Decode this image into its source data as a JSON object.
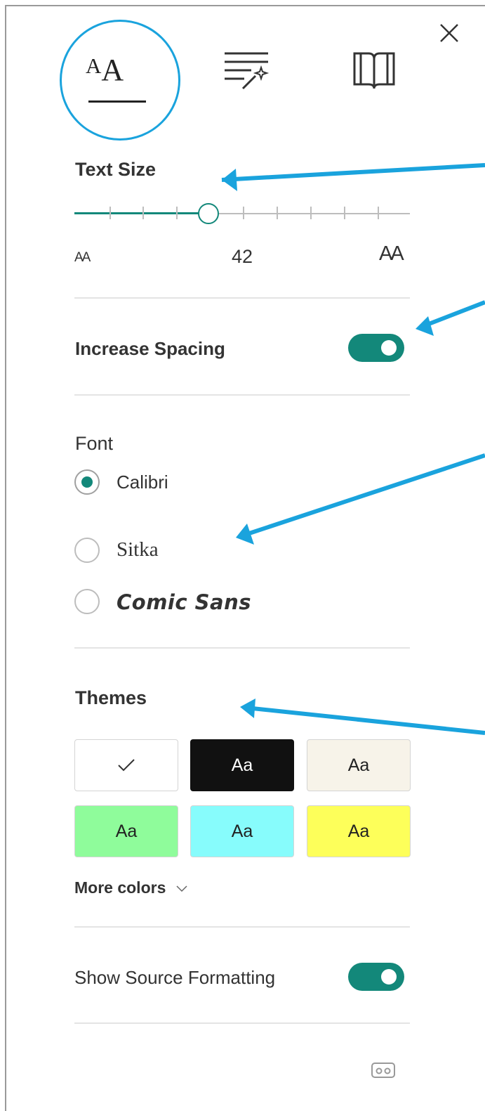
{
  "text_size": {
    "heading": "Text Size",
    "value_label": "42",
    "small_icon_label": "AA",
    "large_icon_label": "AA",
    "slider_value": 4,
    "slider_steps": 10
  },
  "spacing": {
    "label": "Increase Spacing",
    "enabled": true
  },
  "font": {
    "heading": "Font",
    "options": [
      "Calibri",
      "Sitka",
      "Comic Sans"
    ],
    "selected": "Calibri"
  },
  "themes": {
    "heading": "Themes",
    "swatch_text": "Aa",
    "selected_mark": "✓",
    "swatches": [
      {
        "bg": "#ffffff",
        "fg": "#222222",
        "selected": true
      },
      {
        "bg": "#111111",
        "fg": "#ffffff",
        "selected": false
      },
      {
        "bg": "#f7f3e9",
        "fg": "#222222",
        "selected": false
      },
      {
        "bg": "#8ffc9b",
        "fg": "#222222",
        "selected": false
      },
      {
        "bg": "#87fcfc",
        "fg": "#222222",
        "selected": false
      },
      {
        "bg": "#fdff5a",
        "fg": "#222222",
        "selected": false
      }
    ],
    "more_colors": "More colors"
  },
  "source_formatting": {
    "label": "Show Source Formatting",
    "enabled": true
  },
  "colors": {
    "accent": "#13887a",
    "highlight_circle": "#1aa3dd",
    "arrow": "#1aa3dd"
  },
  "icons": [
    "close-icon",
    "text-options-icon",
    "grammar-tools-icon",
    "reading-preferences-icon",
    "immersive-reader-icon"
  ]
}
